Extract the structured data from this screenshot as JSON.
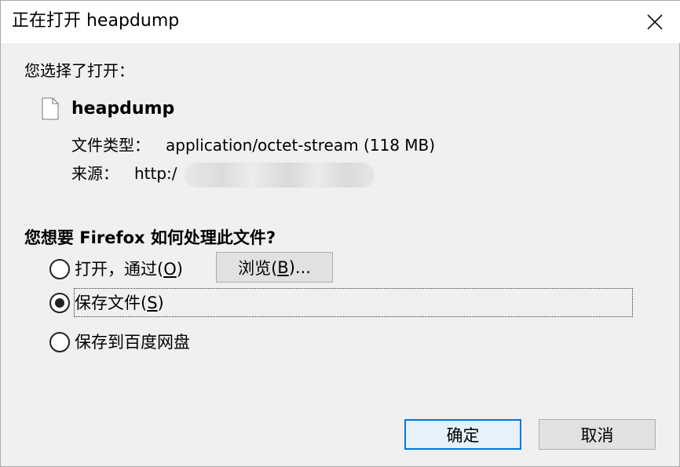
{
  "dialog": {
    "title": "正在打开 heapdump"
  },
  "intro": "您选择了打开：",
  "file": {
    "name": "heapdump",
    "type_label": "文件类型：",
    "type_value": "application/octet-stream (118 MB)",
    "source_label": "来源：",
    "source_value": "http:/"
  },
  "question": "您想要 Firefox 如何处理此文件?",
  "options": [
    {
      "label_pre": "打开，通过(",
      "accel": "O",
      "label_post": ")",
      "checked": false
    },
    {
      "label_pre": "保存文件(",
      "accel": "S",
      "label_post": ")",
      "checked": true
    },
    {
      "label": "保存到百度网盘",
      "checked": false
    }
  ],
  "buttons": {
    "browse_pre": "浏览(",
    "browse_accel": "B",
    "browse_post": ")...",
    "ok": "确定",
    "cancel": "取消"
  },
  "colors": {
    "focus_border": "#0078d7",
    "button_bg": "#e1e1e1",
    "window_bg": "#f0f0f0"
  }
}
